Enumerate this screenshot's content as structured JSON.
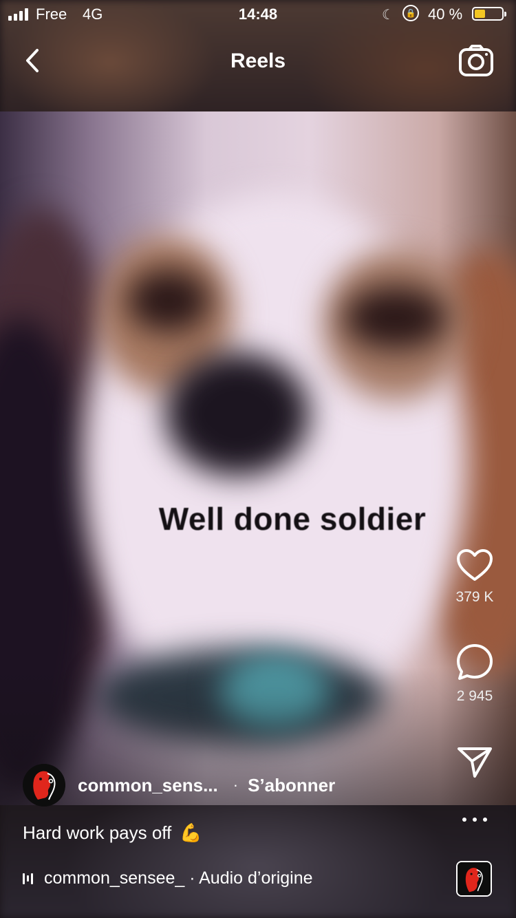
{
  "status_bar": {
    "carrier": "Free",
    "network": "4G",
    "time": "14:48",
    "battery_percent": "40 %",
    "battery_level": 0.4,
    "battery_color": "#f3c623"
  },
  "nav": {
    "title": "Reels",
    "back_icon": "chevron-left-icon",
    "camera_icon": "camera-icon"
  },
  "video": {
    "overlay_text": "Well done soldier"
  },
  "actions": {
    "like_count": "379 K",
    "comment_count": "2 945",
    "like_icon": "heart-icon",
    "comment_icon": "comment-icon",
    "share_icon": "send-icon",
    "more_icon": "more-icon"
  },
  "author": {
    "username": "common_sens...",
    "separator": "·",
    "follow_label": "S’abonner"
  },
  "caption": {
    "text": "Hard work pays off",
    "emoji": "💪"
  },
  "audio": {
    "text": "common_sensee_ · Audio d’origine"
  }
}
